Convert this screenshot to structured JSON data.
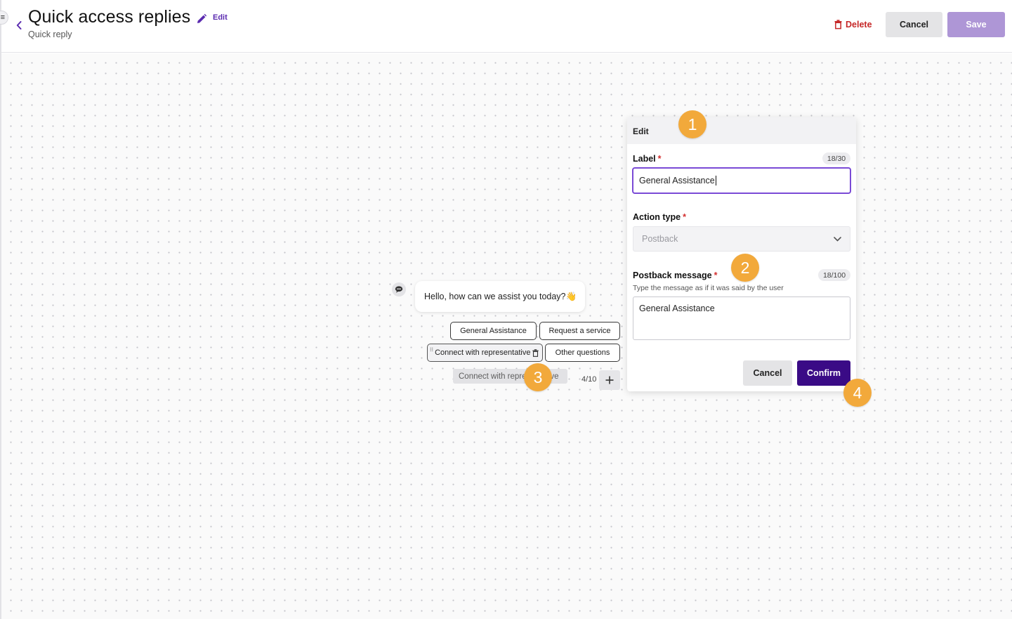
{
  "header": {
    "title": "Quick access replies",
    "edit_label": "Edit",
    "subtitle": "Quick reply",
    "delete_label": "Delete",
    "cancel_label": "Cancel",
    "save_label": "Save"
  },
  "canvas": {
    "bot_message": "Hello, how can we assist you today?👋",
    "chips": [
      "General Assistance",
      "Request a service",
      "Connect with representative",
      "Other questions"
    ],
    "drag_ghost_label": "Connect with representative",
    "chip_count": "4/10"
  },
  "edit_panel": {
    "title": "Edit",
    "label_field": {
      "label": "Label",
      "required_mark": "*",
      "counter": "18/30",
      "value": "General Assistance"
    },
    "action_type": {
      "label": "Action type",
      "required_mark": "*",
      "selected": "Postback"
    },
    "postback": {
      "label": "Postback message",
      "required_mark": "*",
      "counter": "18/100",
      "helper": "Type the message as if it was said by the user",
      "value": "General Assistance"
    },
    "cancel_label": "Cancel",
    "confirm_label": "Confirm"
  },
  "annotations": [
    "1",
    "2",
    "3",
    "4"
  ],
  "colors": {
    "accent": "#5b2bb0",
    "confirm": "#3a0b86",
    "save_disabled": "#ae96d6",
    "delete": "#c62828",
    "badge": "#f2a93b"
  },
  "icons": {
    "back": "chevron-left-icon",
    "edit": "pencil-icon",
    "delete": "trash-icon",
    "dropdown": "chevron-down-icon",
    "add": "plus-icon",
    "bot": "chat-bubble-icon",
    "drag": "drag-handle-icon"
  }
}
